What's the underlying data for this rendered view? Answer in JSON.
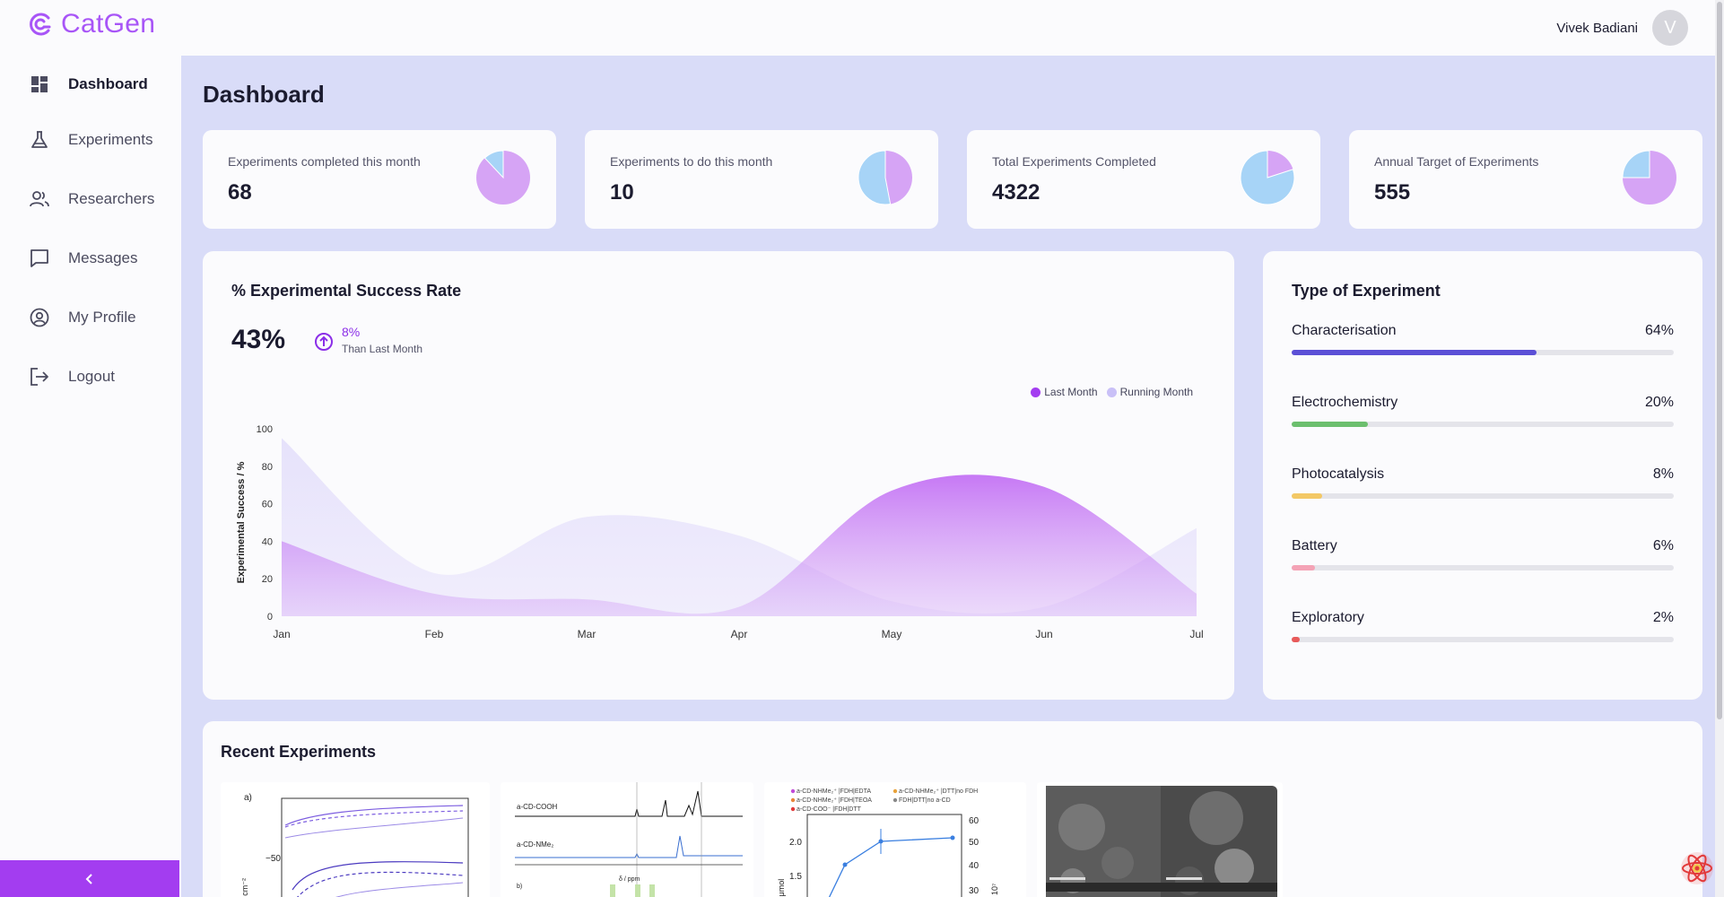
{
  "app": {
    "name": "CatGen"
  },
  "user": {
    "name": "Vivek Badiani",
    "initial": "V"
  },
  "sidebar": {
    "items": [
      {
        "label": "Dashboard",
        "icon": "dashboard-icon",
        "active": true
      },
      {
        "label": "Experiments",
        "icon": "flask-icon"
      },
      {
        "label": "Researchers",
        "icon": "people-icon"
      },
      {
        "label": "Messages",
        "icon": "message-icon"
      },
      {
        "label": "My Profile",
        "icon": "user-circle-icon"
      },
      {
        "label": "Logout",
        "icon": "logout-icon"
      }
    ],
    "collapse_icon": "chevron-left-icon"
  },
  "page": {
    "title": "Dashboard"
  },
  "stats": [
    {
      "label": "Experiments completed this month",
      "value": "68",
      "pie_share": 0.12
    },
    {
      "label": "Experiments to do this month",
      "value": "10",
      "pie_share": 0.53
    },
    {
      "label": "Total Experiments Completed",
      "value": "4322",
      "pie_share": 0.8
    },
    {
      "label": "Annual Target of Experiments",
      "value": "555",
      "pie_share": 0.25
    }
  ],
  "success": {
    "title": "% Experimental Success Rate",
    "value": "43%",
    "delta": "8%",
    "delta_label": "Than Last Month"
  },
  "types": {
    "title": "Type of Experiment",
    "items": [
      {
        "name": "Characterisation",
        "pct": "64%",
        "value": 64,
        "color": "#5b4fd6"
      },
      {
        "name": "Electrochemistry",
        "pct": "20%",
        "value": 20,
        "color": "#6cbf6e"
      },
      {
        "name": "Photocatalysis",
        "pct": "8%",
        "value": 8,
        "color": "#f3c865"
      },
      {
        "name": "Battery",
        "pct": "6%",
        "value": 6,
        "color": "#f4a3b6"
      },
      {
        "name": "Exploratory",
        "pct": "2%",
        "value": 2,
        "color": "#e85a5a"
      }
    ]
  },
  "recent": {
    "title": "Recent Experiments"
  },
  "colors": {
    "accent": "#a33df0",
    "main_bg": "#d9dcf8",
    "last_month": "#b54df2",
    "running_month": "#d4cbf7"
  },
  "chart_data": {
    "type": "area",
    "ylabel": "Experimental Success / %",
    "xlabel": "",
    "categories": [
      "Jan",
      "Feb",
      "Mar",
      "Apr",
      "May",
      "Jun",
      "Jul"
    ],
    "ylim": [
      0,
      100
    ],
    "yticks": [
      0,
      20,
      40,
      60,
      80,
      100
    ],
    "legend_position": "top-right",
    "series": [
      {
        "name": "Last Month",
        "color": "#b54df2",
        "values": [
          40,
          12,
          9,
          5,
          67,
          69,
          12
        ]
      },
      {
        "name": "Running Month",
        "color": "#d4cbf7",
        "values": [
          95,
          23,
          53,
          43,
          8,
          5,
          47
        ]
      }
    ]
  }
}
